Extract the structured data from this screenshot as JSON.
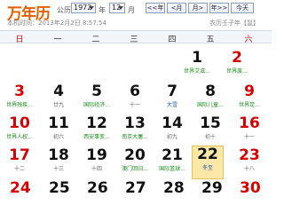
{
  "header": {
    "title": "万年历",
    "calendar_type": "公历",
    "year_value": "1972",
    "year_unit": "年",
    "month_value": "12",
    "month_unit": "月",
    "nav_buttons": [
      "<<年",
      "<月",
      "月>",
      "年>>",
      "今天"
    ],
    "local_time": "本机时间：2013年2月2日 8:57:54",
    "ganzhi": "农历壬子年【鼠】"
  },
  "weekdays": [
    "日",
    "一",
    "二",
    "三",
    "四",
    "五",
    "六"
  ],
  "calendar": {
    "rows": [
      [
        {
          "num": "",
          "sub": ""
        },
        {
          "num": "",
          "sub": ""
        },
        {
          "num": "",
          "sub": ""
        },
        {
          "num": "",
          "sub": ""
        },
        {
          "num": "",
          "sub": ""
        },
        {
          "num": "1",
          "sub": "世界艾滋..."
        },
        {
          "num": "2",
          "sub": "世界废..."
        }
      ],
      [
        {
          "num": "3",
          "sub": "世界残疾..."
        },
        {
          "num": "4",
          "sub": "廿九"
        },
        {
          "num": "5",
          "sub": "国际经济..."
        },
        {
          "num": "6",
          "sub": "十一"
        },
        {
          "num": "7",
          "sub": "大雪"
        },
        {
          "num": "8",
          "sub": "国际儿童..."
        },
        {
          "num": "9",
          "sub": "世界足..."
        }
      ],
      [
        {
          "num": "10",
          "sub": "世界人权..."
        },
        {
          "num": "11",
          "sub": "初六"
        },
        {
          "num": "12",
          "sub": "西安事变..."
        },
        {
          "num": "13",
          "sub": "南京大屠..."
        },
        {
          "num": "14",
          "sub": "初九"
        },
        {
          "num": "15",
          "sub": "初十"
        },
        {
          "num": "16",
          "sub": "十一"
        }
      ],
      [
        {
          "num": "17",
          "sub": "十二"
        },
        {
          "num": "18",
          "sub": "十三"
        },
        {
          "num": "19",
          "sub": "十四"
        },
        {
          "num": "20",
          "sub": "澳门回归..."
        },
        {
          "num": "21",
          "sub": "国际篮球..."
        },
        {
          "num": "22",
          "sub": "冬至"
        },
        {
          "num": "23",
          "sub": "十八"
        }
      ]
    ],
    "partial_row": [
      "24",
      "25",
      "26",
      "27",
      "28",
      "29",
      "30"
    ]
  },
  "colors": {
    "title": "#e06000",
    "weekend_red": "#d40000",
    "festival_green": "#1a8a1a",
    "solar_term_blue": "#2255aa",
    "today_bg": "#fbe8a8"
  }
}
